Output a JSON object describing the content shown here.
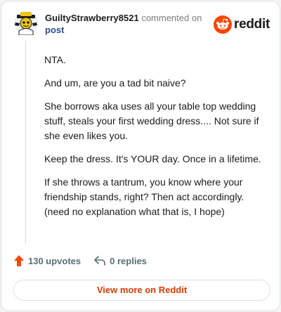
{
  "comment": {
    "username": "GuiltyStrawberry8521",
    "action_text": "commented on",
    "post_link": "post",
    "paragraphs": [
      "NTA.",
      "And um, are you a tad bit naive?",
      "She borrows aka uses all your table top wedding stuff, steals your first wedding dress.... Not sure if she even likes you.",
      "Keep the dress. It's YOUR day. Once in a lifetime.",
      "If she throws a tantrum, you know where your friendship stands, right? Then act accordingly. (need no explanation what that is, I hope)"
    ]
  },
  "brand": {
    "name": "reddit",
    "icon": "reddit-snoo-icon",
    "color": "#ff4500"
  },
  "stats": {
    "upvotes": "130 upvotes",
    "replies": "0 replies",
    "upvote_icon": "upvote-arrow-icon",
    "reply_icon": "reply-arrow-icon",
    "upvote_color": "#ff4500"
  },
  "view_more_label": "View more on Reddit",
  "colors": {
    "link": "#2a4f88",
    "cta": "#d93a00",
    "muted": "#576f76"
  }
}
